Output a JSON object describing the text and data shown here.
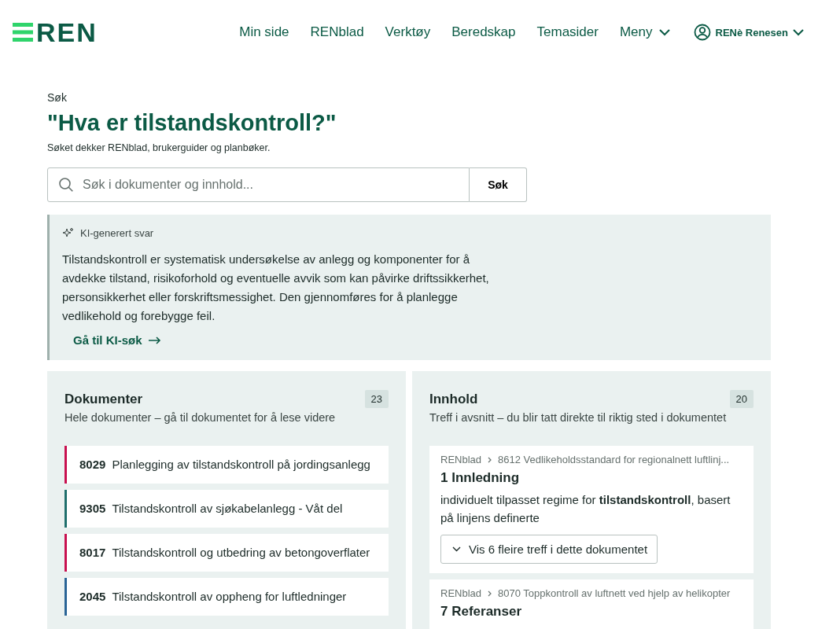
{
  "header": {
    "logo": "REN",
    "nav": [
      {
        "label": "Min side",
        "dropdown": false
      },
      {
        "label": "RENblad",
        "dropdown": false
      },
      {
        "label": "Verktøy",
        "dropdown": false
      },
      {
        "label": "Beredskap",
        "dropdown": false
      },
      {
        "label": "Temasider",
        "dropdown": false
      },
      {
        "label": "Meny",
        "dropdown": true
      }
    ],
    "user": "RENè Renesen"
  },
  "search": {
    "breadcrumb": "Søk",
    "query": "\"Hva er tilstandskontroll?\"",
    "scope": "Søket dekker RENblad, brukerguider og planbøker.",
    "placeholder": "Søk i dokumenter og innhold...",
    "button": "Søk"
  },
  "ai_answer": {
    "label": "KI-generert svar",
    "text": "Tilstandskontroll er systematisk undersøkelse av anlegg og komponenter for å avdekke tilstand, risikoforhold og eventuelle avvik som kan påvirke driftssikkerhet, personsikkerhet eller forskriftsmessighet. Den gjennomføres for å planlegge vedlikehold og forebygge feil.",
    "link": "Gå til KI-søk"
  },
  "documents": {
    "title": "Dokumenter",
    "count": "23",
    "subtitle": "Hele dokumenter – gå til dokumentet for å lese videre",
    "items": [
      {
        "number": "8029",
        "title": "Planlegging av tilstandskontroll på jordingsanlegg",
        "color": "#c8104f"
      },
      {
        "number": "9305",
        "title": "Tilstandskontroll av sjøkabelanlegg - Våt del",
        "color": "#1f6f6c"
      },
      {
        "number": "8017",
        "title": "Tilstandskontroll og utbedring av betongoverflater",
        "color": "#c8104f"
      },
      {
        "number": "2045",
        "title": "Tilstandskontroll av oppheng for luftledninger",
        "color": "#2a6496"
      }
    ]
  },
  "content": {
    "title": "Innhold",
    "count": "20",
    "subtitle": "Treff i avsnitt – du blir tatt direkte til riktig sted i dokumentet",
    "results": [
      {
        "source": "RENblad",
        "document": "8612 Vedlikeholdsstandard for regionalnett luftlinj...",
        "section": "1 Innledning",
        "snippet": "individuelt tilpasset regime for **tilstandskontroll**, basert på linjens definerte",
        "more": "Vis 6 fleire treff i dette dokumentet"
      },
      {
        "source": "RENblad",
        "document": "8070 Toppkontroll av luftnett ved hjelp av helikopter",
        "section": "7 Referanser"
      }
    ]
  }
}
